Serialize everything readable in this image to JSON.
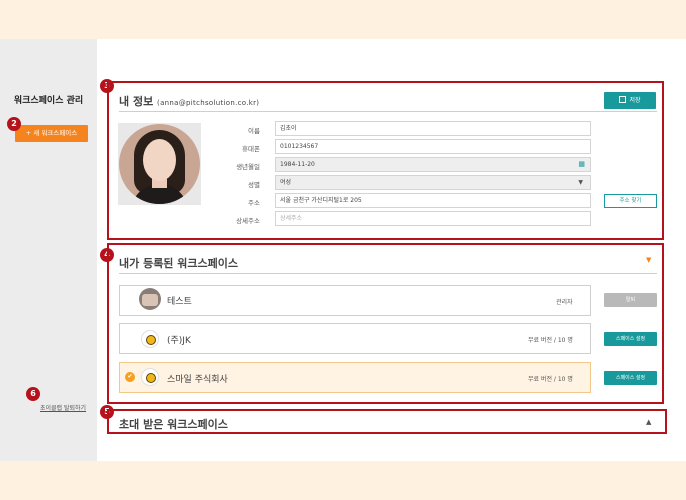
{
  "sidebar": {
    "title": "워크스페이스 관리",
    "new_workspace_button": "+ 새 워크스페이스",
    "leave_link": "초이클랩 탈퇴하기"
  },
  "badges": [
    "2",
    "3",
    "4",
    "5",
    "6"
  ],
  "my_info": {
    "title": "내 정보",
    "email": "(anna@pitchsolution.co.kr)",
    "save_button": "저장",
    "fields": {
      "name": {
        "label": "이름",
        "value": "김초이"
      },
      "phone": {
        "label": "휴대폰",
        "value": "0101234567"
      },
      "birth": {
        "label": "생년월일",
        "value": "1984-11-20"
      },
      "gender": {
        "label": "성별",
        "value": "여성"
      },
      "address": {
        "label": "주소",
        "value": "서울 금천구 가산디지털1로 205"
      },
      "address_detail": {
        "label": "상세주소",
        "placeholder": "상세주소"
      }
    },
    "address_search_button": "주소 찾기"
  },
  "my_workspaces": {
    "title": "내가 등록된 워크스페이스",
    "items": [
      {
        "name": "테스트",
        "role": "관리자",
        "button": "탈퇴"
      },
      {
        "name": "(주)JK",
        "role": "무료 버전 / 10 명",
        "button": "스페이스 설정"
      },
      {
        "name": "스마일 주식회사",
        "role": "무료 버전 / 10 명",
        "button": "스페이스 설정"
      }
    ]
  },
  "invited_workspaces": {
    "title": "초대 받은 워크스페이스"
  },
  "colors": {
    "accent_orange": "#f5841f",
    "teal": "#18999b",
    "annotation_red": "#b5121b"
  }
}
